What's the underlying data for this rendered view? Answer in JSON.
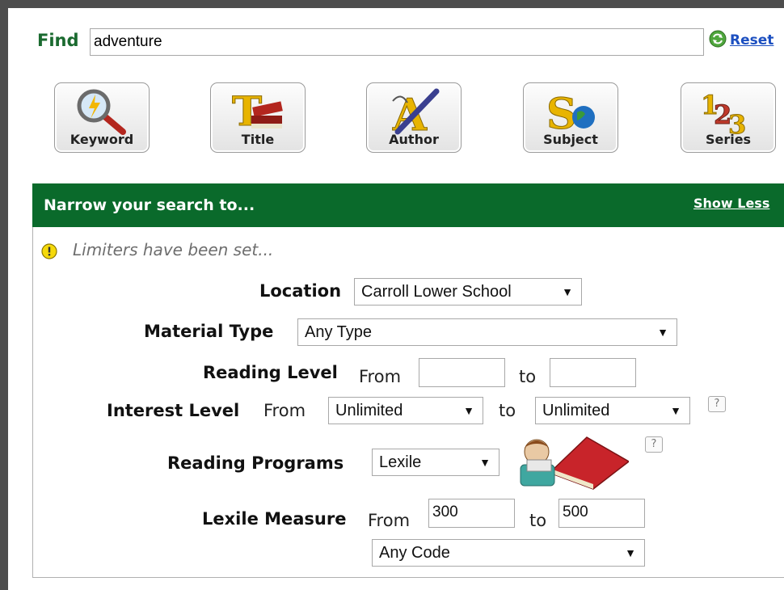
{
  "find": {
    "label": "Find",
    "value": "adventure",
    "reset_label": "Reset"
  },
  "search_buttons": [
    {
      "label": "Keyword",
      "icon": "magnifier-icon"
    },
    {
      "label": "Title",
      "icon": "title-books-icon"
    },
    {
      "label": "Author",
      "icon": "author-quill-icon"
    },
    {
      "label": "Subject",
      "icon": "subject-globe-icon"
    },
    {
      "label": "Series",
      "icon": "series-numbers-icon"
    }
  ],
  "narrow": {
    "title": "Narrow your search to...",
    "toggle_label": "Show Less",
    "notice": "Limiters have been set..."
  },
  "limiters": {
    "location": {
      "label": "Location",
      "value": "Carroll Lower School"
    },
    "material_type": {
      "label": "Material Type",
      "value": "Any Type"
    },
    "reading_level": {
      "label": "Reading Level",
      "from": "From",
      "to": "to",
      "from_value": "",
      "to_value": ""
    },
    "interest_level": {
      "label": "Interest Level",
      "from": "From",
      "to": "to",
      "from_value": "Unlimited",
      "to_value": "Unlimited"
    },
    "reading_programs": {
      "label": "Reading Programs",
      "value": "Lexile"
    },
    "lexile_measure": {
      "label": "Lexile Measure",
      "from": "From",
      "to": "to",
      "from_value": "300",
      "to_value": "500",
      "code_value": "Any Code"
    },
    "help_label": "?"
  },
  "colors": {
    "header_green": "#0a6a2b",
    "find_label": "#1a6a2f",
    "link_blue": "#1c4fc0"
  }
}
